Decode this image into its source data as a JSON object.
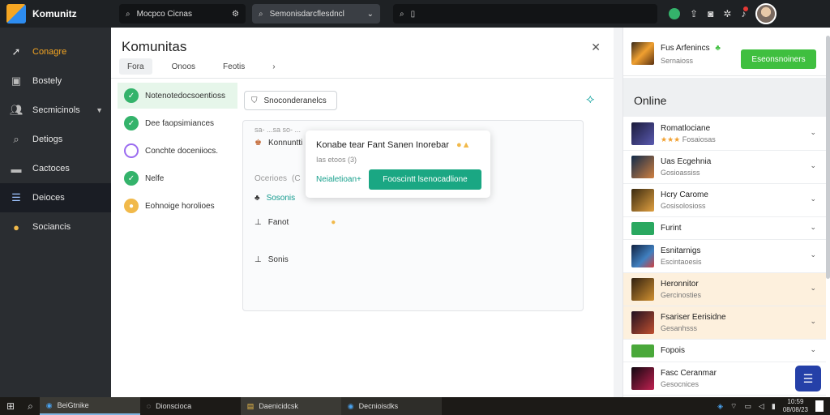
{
  "topbar": {
    "app_name": "Komunitz",
    "search1": "Mocpco Cicnas",
    "search2": "Semonisdarcflesdncl",
    "search3": ""
  },
  "sidebar": {
    "items": [
      {
        "label": "Conagre",
        "icon": "arrow-icon"
      },
      {
        "label": "Bostely",
        "icon": "image-icon"
      },
      {
        "label": "Secmicinols",
        "icon": "users-icon"
      },
      {
        "label": "Detiogs",
        "icon": "search-icon"
      },
      {
        "label": "Cactoces",
        "icon": "monitor-icon"
      },
      {
        "label": "Deioces",
        "icon": "layout-icon"
      },
      {
        "label": "Sociancis",
        "icon": "medal-icon"
      }
    ]
  },
  "main": {
    "title": "Komunitas",
    "tabs": [
      "Fora",
      "Onoos",
      "Feotis",
      "›"
    ],
    "steps": [
      {
        "label": "Notenotedocsoentioss",
        "state": "done"
      },
      {
        "label": "Dee faopsimiances",
        "state": "done"
      },
      {
        "label": "Conchte doceniiocs.",
        "state": "pending"
      },
      {
        "label": "Nelfe",
        "state": "done"
      },
      {
        "label": "Eohnoige horolioes",
        "state": "medal"
      }
    ],
    "pill_label": "Snoconderanelcs",
    "panel": {
      "faint": "sa- ...sa so- ...",
      "title": "Konnuntti",
      "sub": "Ocerioes",
      "sub_suffix": "(C",
      "rows": [
        "Sosonis",
        "Fanot",
        "Sonis"
      ]
    },
    "popup": {
      "title": "Konabe tear Fant Sanen Inorebar",
      "sub": "Ias etoos (3)",
      "link": "Neialetioan+",
      "button": "Fooscintt lsenocadlione"
    }
  },
  "right": {
    "top_title": "Fus Arfenincs",
    "top_sub": "Sernaioss",
    "top_button": "Eseonsnoiners",
    "online_heading": "Online",
    "items": [
      {
        "name": "Romatlociane",
        "status": "Fosaiosas",
        "hl": false
      },
      {
        "name": "Uas Ecgehnia",
        "status": "Gosioassiss",
        "hl": false
      },
      {
        "name": "Hcry Carome",
        "status": "Gosisolosioss",
        "hl": false
      },
      {
        "name": "Furint",
        "status": "",
        "hl": false
      },
      {
        "name": "Esnitarnigs",
        "status": "Escintaoesis",
        "hl": false
      },
      {
        "name": "Heronnitor",
        "status": "Gercinosties",
        "hl": true
      },
      {
        "name": "Fsariser Eerisidne",
        "status": "Gesanhsss",
        "hl": true
      },
      {
        "name": "Fopois",
        "status": "",
        "hl": false
      },
      {
        "name": "Fasc Ceranmar",
        "status": "Gesocnices",
        "hl": false
      }
    ]
  },
  "taskbar": {
    "apps": [
      "BeiGtnike",
      "Dionscioca",
      "Daenicidcsk",
      "Decnioisdks"
    ],
    "time": "10:59",
    "date": "08/08/23"
  },
  "colors": {
    "accent": "#f5a623",
    "success": "#34b36b",
    "teal": "#1aa783",
    "brand_green": "#3fbf3f",
    "fab": "#2540a8"
  }
}
